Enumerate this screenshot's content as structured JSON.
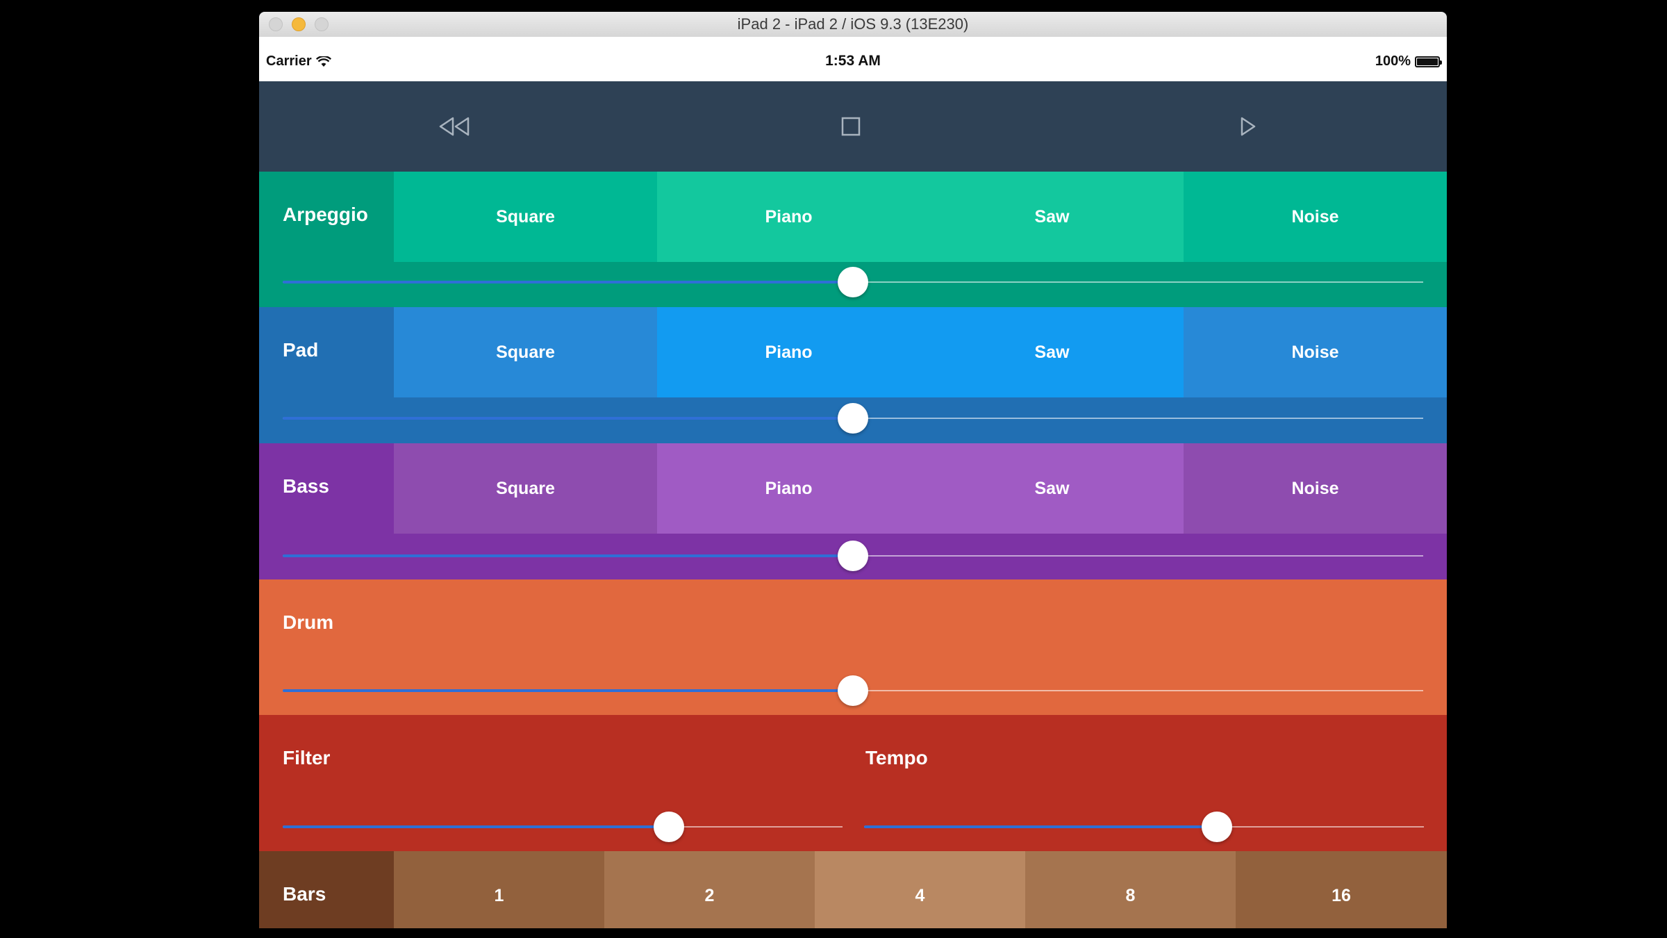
{
  "window": {
    "title": "iPad 2 - iPad 2 / iOS 9.3 (13E230)"
  },
  "status_bar": {
    "carrier": "Carrier",
    "time": "1:53 AM",
    "battery": "100%"
  },
  "transport": {
    "rewind_icon": "rewind-icon",
    "stop_icon": "stop-icon",
    "play_icon": "play-icon"
  },
  "instruments": [
    {
      "name": "Arpeggio",
      "options": [
        "Square",
        "Piano",
        "Saw",
        "Noise"
      ],
      "selected": "Piano",
      "slider_value": 0.5
    },
    {
      "name": "Pad",
      "options": [
        "Square",
        "Piano",
        "Saw",
        "Noise"
      ],
      "selected": "Piano",
      "slider_value": 0.5
    },
    {
      "name": "Bass",
      "options": [
        "Square",
        "Piano",
        "Saw",
        "Noise"
      ],
      "selected": "Piano",
      "slider_value": 0.5
    }
  ],
  "drum": {
    "name": "Drum",
    "slider_value": 0.5
  },
  "filter": {
    "name": "Filter",
    "slider_value": 0.69
  },
  "tempo": {
    "name": "Tempo",
    "slider_value": 0.63
  },
  "bars": {
    "name": "Bars",
    "options": [
      "1",
      "2",
      "4",
      "8",
      "16"
    ],
    "selected": "4"
  },
  "colors": {
    "transport_bg": "#2e4155",
    "arpeggio_label": "#009c7c",
    "arpeggio_seg": "#00b894",
    "arpeggio_selected": "#13c89e",
    "arpeggio_slider": "#009c7c",
    "pad_label": "#216fb3",
    "pad_seg": "#2789d7",
    "pad_selected": "#129bf1",
    "pad_slider": "#216fb3",
    "bass_label": "#7d33a5",
    "bass_seg": "#8e4caf",
    "bass_selected": "#a05bc4",
    "bass_slider": "#7d33a5",
    "drum_bg": "#e1683e",
    "filter_bg": "#b82f22",
    "bars_label": "#6e3d22",
    "bars_seg_1": "#92613d",
    "bars_seg_2": "#a5744f",
    "bars_selected": "#b98862",
    "bars_seg_8": "#a5744f",
    "bars_seg_16": "#92613d",
    "slider_fill": "#2f6fd6"
  }
}
